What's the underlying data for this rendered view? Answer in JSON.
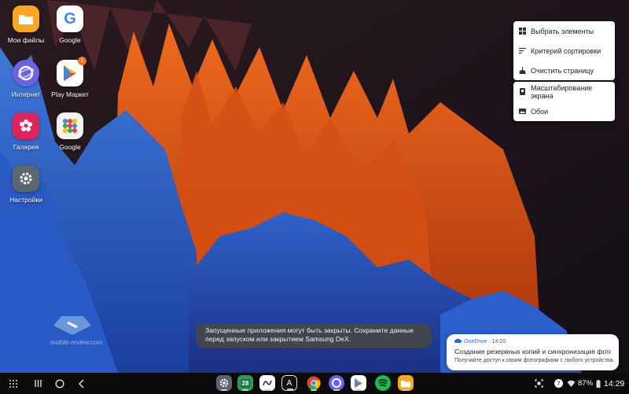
{
  "desktop": {
    "icons": [
      {
        "label": "Мои файлы",
        "icon": "folder-icon",
        "color": "#f5a623"
      },
      {
        "label": "Google",
        "icon": "google-icon",
        "color": "#ffffff"
      },
      {
        "label": "Интернет",
        "icon": "samsung-internet-icon",
        "color": "#6b63e6"
      },
      {
        "label": "Play Маркет",
        "icon": "play-store-icon",
        "color": "#ffffff",
        "badge": "1"
      },
      {
        "label": "Галерея",
        "icon": "gallery-icon",
        "color": "#e0245e"
      },
      {
        "label": "Google",
        "icon": "google-folder-icon",
        "color": "#ffffff"
      },
      {
        "label": "Настройки",
        "icon": "settings-icon",
        "color": "#5b6670"
      }
    ]
  },
  "context_menu": {
    "group1": [
      {
        "label": "Выбрать элементы",
        "icon": "grid-icon"
      },
      {
        "label": "Критерий сортировки",
        "icon": "sort-icon"
      },
      {
        "label": "Очистить страницу",
        "icon": "broom-icon"
      }
    ],
    "group2": [
      {
        "label": "Масштабирование экрана",
        "icon": "screen-zoom-icon"
      },
      {
        "label": "Обои",
        "icon": "wallpaper-icon"
      }
    ]
  },
  "toast": {
    "text": "Запущенные приложения могут быть закрыты. Сохраните данные перед запуском или закрытием Samsung DeX."
  },
  "notification": {
    "app": "OneDrive",
    "time": "14:20",
    "title": "Создание резервных копий и синхронизация фотогра...",
    "body": "Получайте доступ к своим фотографиям с любого устройства."
  },
  "taskbar": {
    "apps": [
      "settings-icon",
      "calendar-icon",
      "sketch-icon",
      "font-icon",
      "chrome-icon",
      "samsung-internet-icon",
      "play-store-icon",
      "spotify-icon",
      "folder-icon"
    ],
    "calendar_day": "28",
    "font_letter": "A",
    "tray": {
      "notif_count": "7",
      "battery": "87%",
      "time": "14:29"
    }
  },
  "watermark": {
    "text": "mobile-review.com"
  },
  "colors": {
    "accent": "#1c6fd6",
    "taskbar": "#0b0b0d",
    "toast": "#46464a"
  }
}
